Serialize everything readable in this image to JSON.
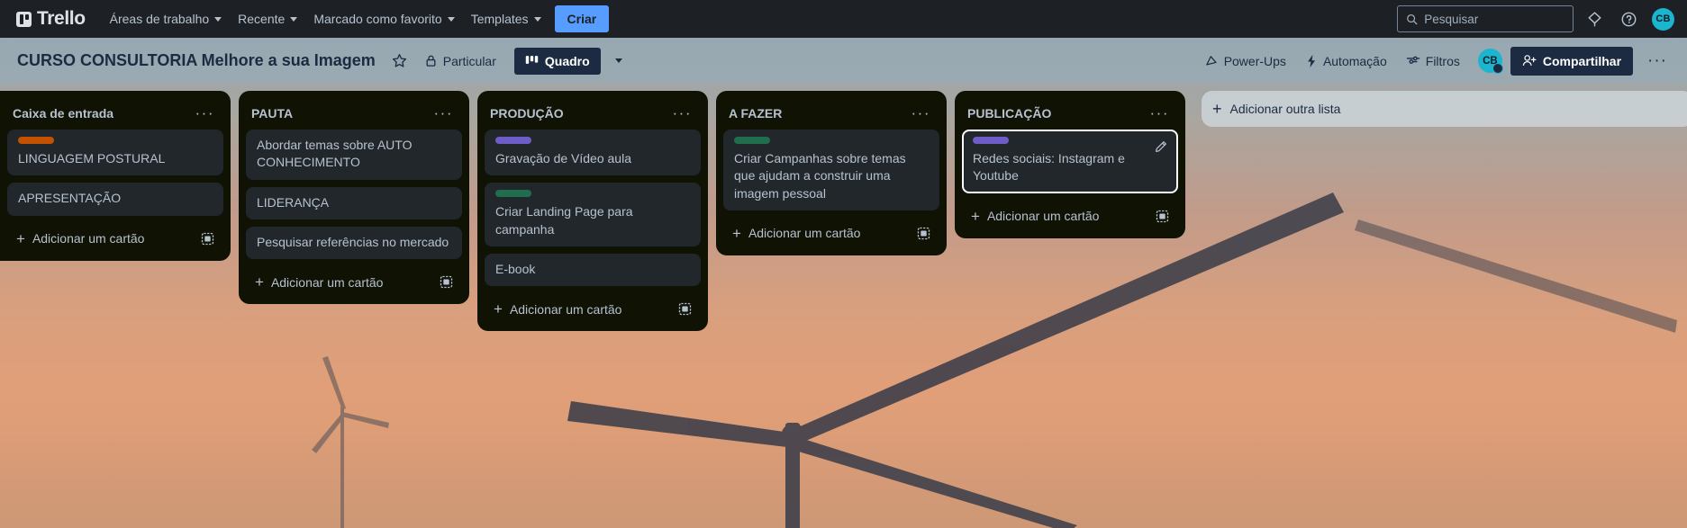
{
  "topnav": {
    "brand": "Trello",
    "items": [
      {
        "label": "Áreas de trabalho",
        "caret": true
      },
      {
        "label": "Recente",
        "caret": true
      },
      {
        "label": "Marcado como favorito",
        "caret": true
      },
      {
        "label": "Templates",
        "caret": true
      }
    ],
    "create_label": "Criar",
    "search_placeholder": "Pesquisar",
    "search_value": "",
    "notifications_icon": "bell-icon",
    "help_icon": "help-circle-icon",
    "avatar_initials": "CB",
    "accent": "#579dff",
    "background": "#1d2125"
  },
  "boardbar": {
    "title": "CURSO CONSULTORIA Melhore a sua Imagem",
    "star_icon": "star-icon",
    "visibility_label": "Particular",
    "visibility_icon": "lock-icon",
    "view_label": "Quadro",
    "view_icon": "board-icon",
    "view_caret_icon": "chevron-down-icon",
    "right_items": [
      {
        "label": "Power-Ups",
        "icon": "rocket-icon"
      },
      {
        "label": "Automação",
        "icon": "bolt-icon"
      },
      {
        "label": "Filtros",
        "icon": "filter-icon"
      }
    ],
    "avatar_initials": "CB",
    "share_label": "Compartilhar",
    "share_icon": "person-add-icon",
    "menu_icon": "more-horizontal-icon",
    "text_color": "#1c2b41"
  },
  "labels": {
    "orange": "#c25100",
    "purple": "#6e5dc6",
    "green": "#216e4e"
  },
  "board": {
    "add_list_label": "Adicionar outra lista",
    "add_card_label": "Adicionar um cartão",
    "list_menu_icon": "more-horizontal-icon",
    "card_template_icon": "card-template-icon",
    "lists": [
      {
        "title": "Caixa de entrada",
        "cards": [
          {
            "text": "LINGUAGEM POSTURAL",
            "label": "orange",
            "selected": false
          },
          {
            "text": "APRESENTAÇÃO",
            "label": null,
            "selected": false
          }
        ]
      },
      {
        "title": "PAUTA",
        "cards": [
          {
            "text": "Abordar temas sobre AUTO CONHECIMENTO",
            "label": null,
            "selected": false
          },
          {
            "text": "LIDERANÇA",
            "label": null,
            "selected": false
          },
          {
            "text": "Pesquisar referências no mercado",
            "label": null,
            "selected": false
          }
        ]
      },
      {
        "title": "PRODUÇÃO",
        "cards": [
          {
            "text": "Gravação de Vídeo aula",
            "label": "purple",
            "selected": false
          },
          {
            "text": "Criar Landing Page para campanha",
            "label": "green",
            "selected": false
          },
          {
            "text": "E-book",
            "label": null,
            "selected": false
          }
        ]
      },
      {
        "title": "A FAZER",
        "cards": [
          {
            "text": "Criar Campanhas sobre temas que ajudam a construir uma imagem pessoal",
            "label": "green",
            "selected": false
          }
        ]
      },
      {
        "title": "PUBLICAÇÃO",
        "cards": [
          {
            "text": "Redes sociais: Instagram e Youtube",
            "label": "purple",
            "selected": true,
            "edit_icon": "pencil-icon"
          }
        ]
      }
    ]
  }
}
